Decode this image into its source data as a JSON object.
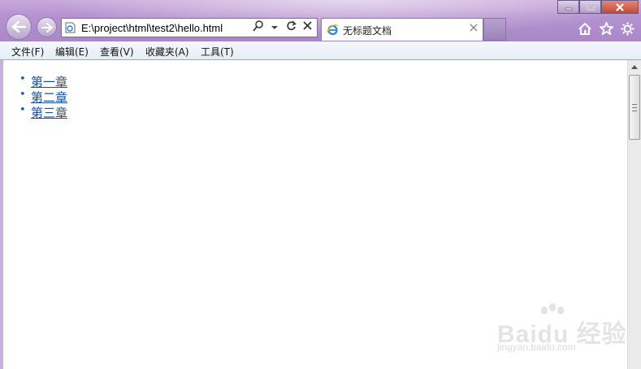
{
  "window": {
    "address": "E:\\project\\html\\test2\\hello.html",
    "tab_title": "无标题文档"
  },
  "toolbar_icons": [
    "back-icon",
    "forward-icon",
    "search-icon",
    "dropdown-icon",
    "refresh-icon",
    "stop-icon",
    "home-icon",
    "favorites-star-icon",
    "settings-gear-icon"
  ],
  "menu": [
    "文件(F)",
    "编辑(E)",
    "查看(V)",
    "收藏夹(A)",
    "工具(T)"
  ],
  "page": {
    "links": [
      "第一章",
      "第二章",
      "第三章"
    ]
  },
  "watermark": {
    "main": "Baidu 经验",
    "sub": "jingyan.baidu.com"
  },
  "colors": {
    "chrome": "#b592cf",
    "link": "#1a4f99",
    "menubar": "#eef3f9"
  }
}
